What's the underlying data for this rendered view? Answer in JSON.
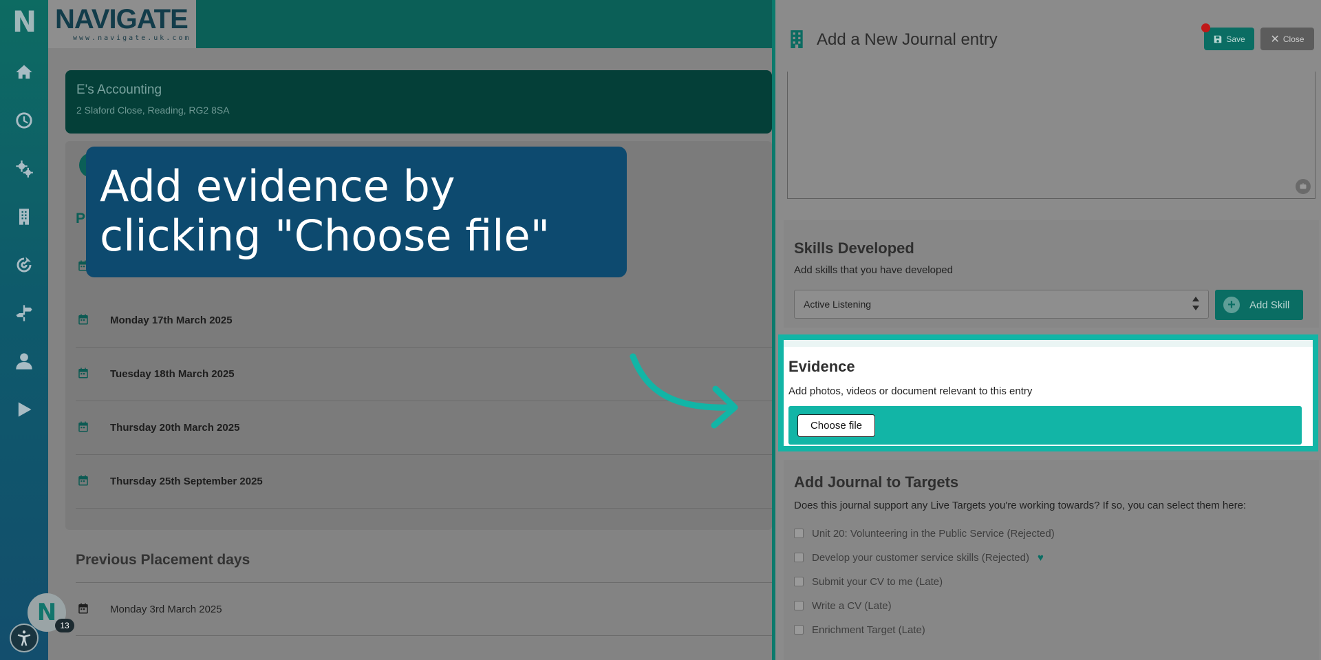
{
  "brand": {
    "title": "NAVIGATE",
    "subtitle": "www.navigate.uk.com",
    "logo_letter": "N"
  },
  "sidebar": {
    "items": [
      {
        "icon": "home-icon"
      },
      {
        "icon": "clock-icon"
      },
      {
        "icon": "gears-icon"
      },
      {
        "icon": "building-icon"
      },
      {
        "icon": "target-icon"
      },
      {
        "icon": "signpost-icon"
      },
      {
        "icon": "user-icon"
      },
      {
        "icon": "play-icon"
      }
    ]
  },
  "company": {
    "name": "E's Accounting",
    "address": "2 Slaford Close, Reading, RG2 8SA"
  },
  "placement": {
    "heading_initial": "P",
    "days": [
      "Monday 17th March 2025",
      "Tuesday 18th March 2025",
      "Thursday 20th March 2025",
      "Thursday 25th September 2025"
    ]
  },
  "previous": {
    "title": "Previous Placement days",
    "days": [
      "Monday 3rd March 2025"
    ]
  },
  "callout": {
    "text": "Add evidence by clicking \"Choose file\""
  },
  "avatar": {
    "letter": "N",
    "badge": "13"
  },
  "modal": {
    "title": "Add a New Journal entry",
    "save_label": "Save",
    "close_label": "Close",
    "skills": {
      "title": "Skills Developed",
      "description": "Add skills that you have developed",
      "selected": "Active Listening",
      "add_label": "Add Skill"
    },
    "evidence": {
      "title": "Evidence",
      "description": "Add photos, videos or document relevant to this entry",
      "button_label": "Choose file"
    },
    "targets": {
      "title": "Add Journal to Targets",
      "description": "Does this journal support any Live Targets you're working towards? If so, you can select them here:",
      "items": [
        "Unit 20: Volunteering in the Public Service (Rejected)",
        "Develop your customer service skills (Rejected)",
        "Submit your CV to me (Late)",
        "Write a CV (Late)",
        "Enrichment Target (Late)"
      ]
    }
  },
  "colors": {
    "accent": "#12b5a6",
    "brand": "#0b6b61",
    "callout": "#0d4a6f"
  }
}
